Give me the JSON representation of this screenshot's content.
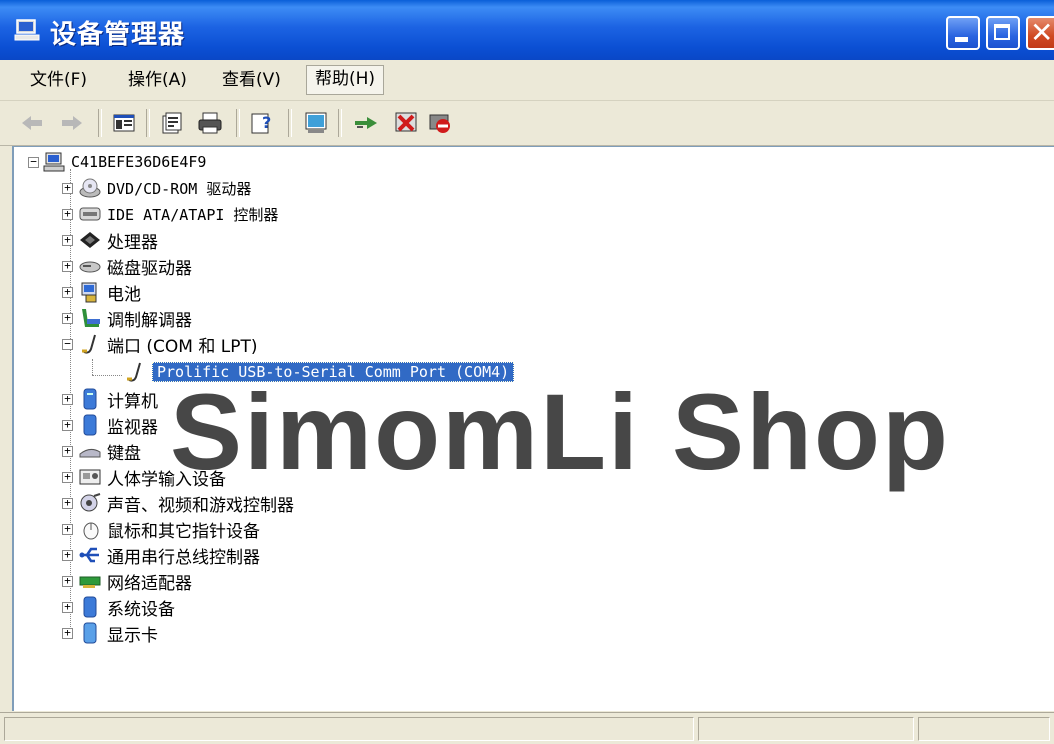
{
  "window": {
    "title": "设备管理器",
    "controls": {
      "minimize_icon": "minimize-icon",
      "maximize_icon": "maximize-icon",
      "close_icon": "close-icon"
    }
  },
  "menu": [
    {
      "label": "文件(F)"
    },
    {
      "label": "操作(A)"
    },
    {
      "label": "查看(V)"
    },
    {
      "label": "帮助(H)",
      "active": true
    }
  ],
  "toolbar": [
    "back-arrow-icon",
    "forward-arrow-icon",
    "show-hide-console-tree-icon",
    "properties-icon",
    "print-icon",
    "help-icon",
    "scan-hardware-icon",
    "update-driver-icon",
    "uninstall-icon",
    "disable-icon"
  ],
  "tree": {
    "root": "C41BEFE36D6E4F9",
    "items": [
      {
        "label": "DVD/CD-ROM 驱动器",
        "icon": "dvd-drive-icon"
      },
      {
        "label": "IDE ATA/ATAPI 控制器",
        "icon": "ide-controller-icon"
      },
      {
        "label": "处理器",
        "icon": "processor-icon"
      },
      {
        "label": "磁盘驱动器",
        "icon": "disk-drive-icon"
      },
      {
        "label": "电池",
        "icon": "battery-icon"
      },
      {
        "label": "调制解调器",
        "icon": "modem-icon"
      },
      {
        "label": "端口 (COM 和 LPT)",
        "icon": "port-icon",
        "expanded": true,
        "children": [
          {
            "label": "Prolific USB-to-Serial Comm Port (COM4)",
            "icon": "port-icon",
            "selected": true
          }
        ]
      },
      {
        "label": "计算机",
        "icon": "computer-icon"
      },
      {
        "label": "监视器",
        "icon": "monitor-icon"
      },
      {
        "label": "键盘",
        "icon": "keyboard-icon"
      },
      {
        "label": "人体学输入设备",
        "icon": "hid-icon"
      },
      {
        "label": "声音、视频和游戏控制器",
        "icon": "sound-icon"
      },
      {
        "label": "鼠标和其它指针设备",
        "icon": "mouse-icon"
      },
      {
        "label": "通用串行总线控制器",
        "icon": "usb-icon"
      },
      {
        "label": "网络适配器",
        "icon": "network-adapter-icon"
      },
      {
        "label": "系统设备",
        "icon": "system-device-icon"
      },
      {
        "label": "显示卡",
        "icon": "display-adapter-icon"
      }
    ]
  },
  "watermark": "SimomLi Shop",
  "colors": {
    "title_blue": "#0b4fd3",
    "selection": "#316ac5",
    "chrome": "#ece9d8",
    "close_red": "#d04a23"
  }
}
